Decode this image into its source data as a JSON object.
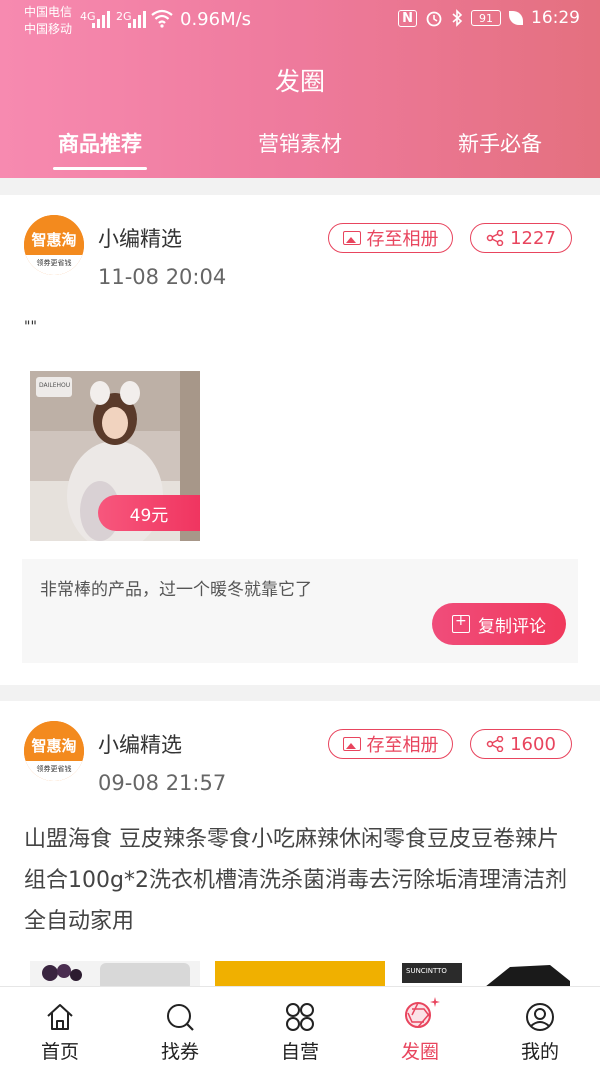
{
  "status_bar": {
    "carrier_1": "中国电信",
    "carrier_2": "中国移动",
    "net_1": "4G",
    "net_2": "2G",
    "speed": "0.96M/s",
    "nfc": "N",
    "battery": "91",
    "time": "16:29"
  },
  "header": {
    "title": "发圈",
    "tabs": [
      {
        "label": "商品推荐",
        "active": true
      },
      {
        "label": "营销素材",
        "active": false
      },
      {
        "label": "新手必备",
        "active": false
      }
    ]
  },
  "posts": [
    {
      "author": "小编精选",
      "avatar_brand": "智惠淘",
      "avatar_slogan": "领券更省钱",
      "time": "11-08 20:04",
      "save_label": "存至相册",
      "share_count": "1227",
      "text": "\"\"",
      "image_price": "49元",
      "image_brand": "DAILEHOU",
      "comment": "非常棒的产品，过一个暖冬就靠它了",
      "copy_label": "复制评论"
    },
    {
      "author": "小编精选",
      "avatar_brand": "智惠淘",
      "avatar_slogan": "领券更省钱",
      "time": "09-08 21:57",
      "save_label": "存至相册",
      "share_count": "1600",
      "text": "山盟海食 豆皮辣条零食小吃麻辣休闲零食豆皮豆卷辣片组合100g*2洗衣机槽清洗杀菌消毒去污除垢清理清洁剂全自动家用",
      "image_brand": "SUNCINTTO"
    }
  ],
  "bottom_nav": [
    {
      "label": "首页",
      "icon": "home-icon",
      "active": false
    },
    {
      "label": "找券",
      "icon": "search-icon",
      "active": false
    },
    {
      "label": "自营",
      "icon": "grid-icon",
      "active": false
    },
    {
      "label": "发圈",
      "icon": "camera-aperture-icon",
      "active": true
    },
    {
      "label": "我的",
      "icon": "user-icon",
      "active": false
    }
  ],
  "colors": {
    "header_start": "#f78ab0",
    "header_end": "#e4707f",
    "accent": "#e8455e",
    "price_tag": "#f03560"
  }
}
